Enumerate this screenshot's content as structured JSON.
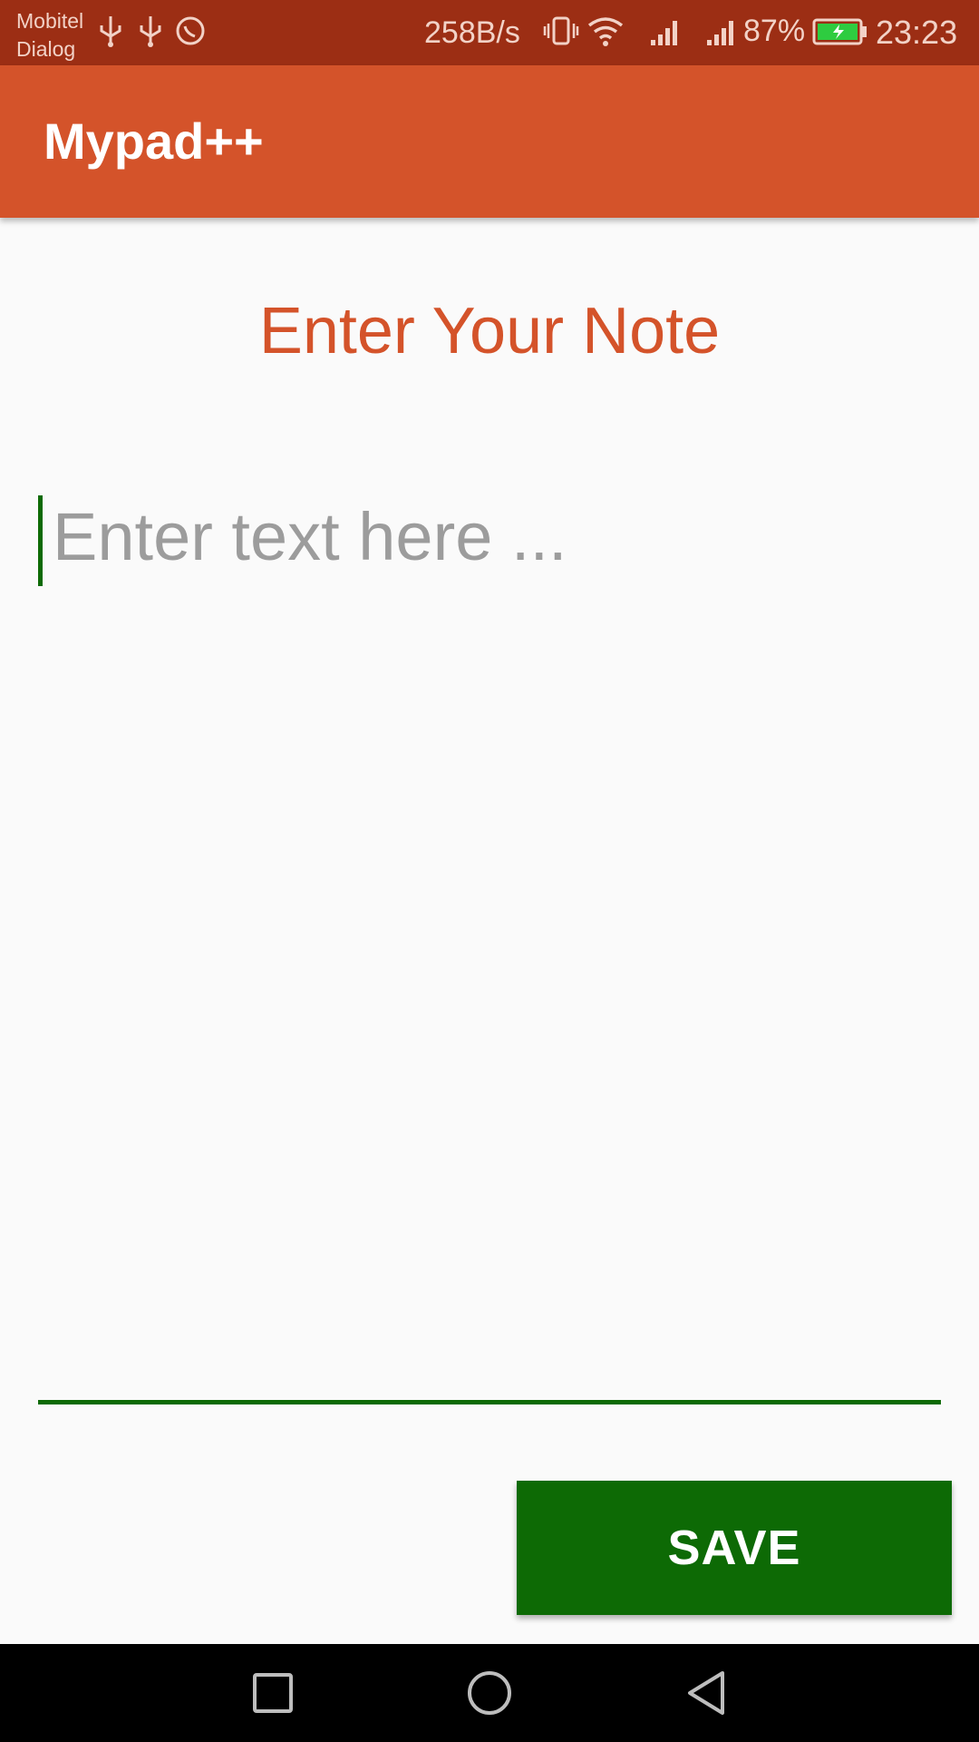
{
  "status_bar": {
    "carrier_line1": "Mobitel",
    "carrier_line2": "Dialog",
    "net_speed": "258B/s",
    "battery_percent": "87%",
    "time": "23:23",
    "icons": [
      "usb-icon",
      "usb-icon",
      "whatsapp-icon",
      "vibrate-icon",
      "wifi-icon",
      "signal-icon",
      "signal-icon",
      "battery-charging-icon"
    ]
  },
  "app_bar": {
    "title": "Mypad++"
  },
  "main": {
    "heading": "Enter Your Note",
    "note_input": {
      "placeholder": "Enter text here ...",
      "value": ""
    },
    "save_label": "SAVE"
  },
  "nav_bar": {
    "buttons": [
      "recents-icon",
      "home-icon",
      "back-icon"
    ]
  },
  "colors": {
    "status_bar": "#9c2e14",
    "primary": "#d4532a",
    "accent": "#0d6a05",
    "background": "#fafafa",
    "nav_bar": "#000000"
  }
}
